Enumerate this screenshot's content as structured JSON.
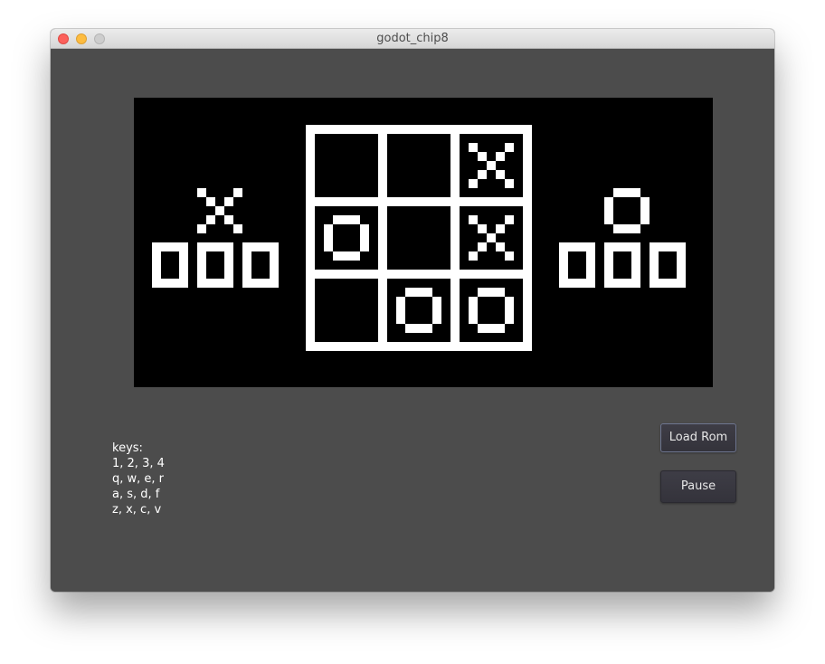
{
  "window": {
    "title": "godot_chip8"
  },
  "screen": {
    "foreground_color": "#ffffff",
    "background_color": "#000000",
    "board": [
      [
        "",
        "",
        "X"
      ],
      [
        "O",
        "",
        "X"
      ],
      [
        "",
        "O",
        "O"
      ]
    ],
    "left_player": {
      "symbol": "X",
      "score_digits": [
        "0",
        "0",
        "0"
      ]
    },
    "right_player": {
      "symbol": "O",
      "score_digits": [
        "0",
        "0",
        "0"
      ]
    }
  },
  "keys": {
    "heading": "keys:",
    "rows": [
      "1, 2, 3, 4",
      "q, w, e, r",
      "a, s, d, f",
      "z, x, c, v"
    ]
  },
  "buttons": {
    "load_rom": "Load Rom",
    "pause": "Pause"
  }
}
